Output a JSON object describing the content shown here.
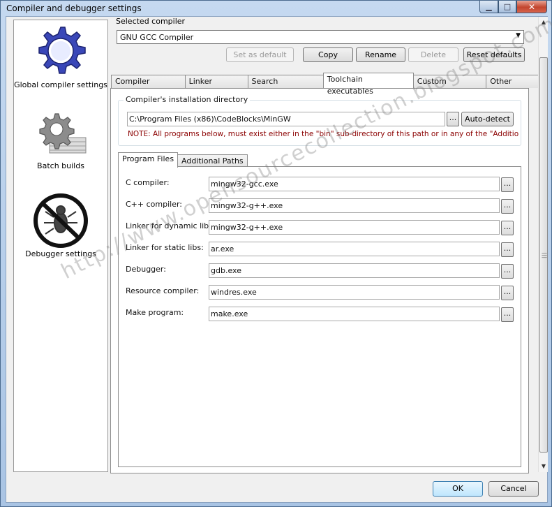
{
  "window": {
    "title": "Compiler and debugger settings"
  },
  "sidebar": {
    "items": [
      {
        "label": "Global compiler settings",
        "icon": "gear-icon"
      },
      {
        "label": "Batch builds",
        "icon": "batch-gear-icon"
      },
      {
        "label": "Debugger settings",
        "icon": "no-bug-icon"
      }
    ]
  },
  "compiler": {
    "selected_label": "Selected compiler",
    "selected_value": "GNU GCC Compiler",
    "buttons": {
      "set_default": "Set as default",
      "copy": "Copy",
      "rename": "Rename",
      "delete": "Delete",
      "reset_defaults": "Reset defaults"
    }
  },
  "tabs": [
    "Compiler settings",
    "Linker settings",
    "Search directories",
    "Toolchain executables",
    "Custom variables",
    "Other settings"
  ],
  "toolchain": {
    "install_dir_title": "Compiler's installation directory",
    "install_dir_value": "C:\\Program Files (x86)\\CodeBlocks\\MinGW",
    "browse": "...",
    "auto_detect": "Auto-detect",
    "note": "NOTE: All programs below, must exist either in the \"bin\" sub-directory of this path or in any of the \"Additional",
    "subtabs": [
      "Program Files",
      "Additional Paths"
    ],
    "programs": [
      {
        "label": "C compiler:",
        "value": "mingw32-gcc.exe"
      },
      {
        "label": "C++ compiler:",
        "value": "mingw32-g++.exe"
      },
      {
        "label": "Linker for dynamic libs:",
        "value": "mingw32-g++.exe"
      },
      {
        "label": "Linker for static libs:",
        "value": "ar.exe"
      },
      {
        "label": "Debugger:",
        "value": "gdb.exe"
      },
      {
        "label": "Resource compiler:",
        "value": "windres.exe"
      },
      {
        "label": "Make program:",
        "value": "make.exe"
      }
    ]
  },
  "dialog": {
    "ok": "OK",
    "cancel": "Cancel"
  },
  "watermark": "http://www.opensourcecollection.blogspot.com/",
  "colors": {
    "note": "#8b0000",
    "close_button": "#c3452e"
  }
}
